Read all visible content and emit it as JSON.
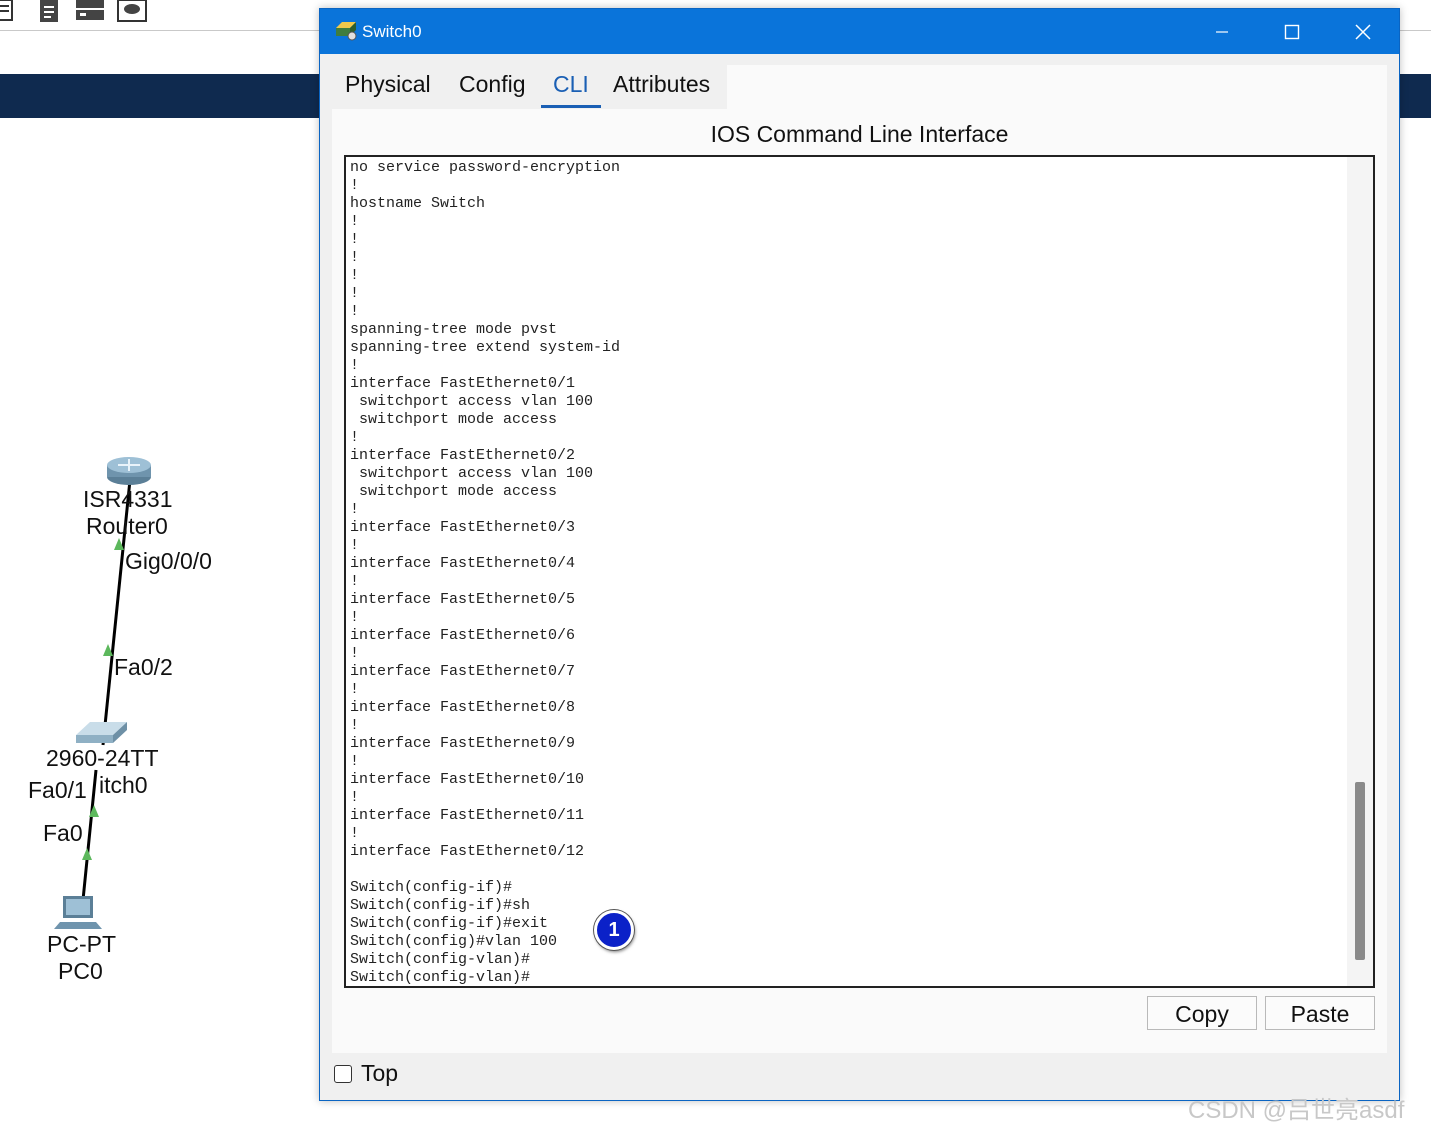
{
  "workspace": {
    "devices": {
      "router": {
        "model": "ISR4331",
        "name": "Router0"
      },
      "switch": {
        "model": "2960-24TT",
        "name_partial": "itch0"
      },
      "pc": {
        "model": "PC-PT",
        "name": "PC0"
      }
    },
    "ports": {
      "router_port": "Gig0/0/0",
      "switch_up_port": "Fa0/2",
      "switch_down_port": "Fa0/1",
      "pc_port": "Fa0"
    }
  },
  "window": {
    "title": "Switch0",
    "tabs": [
      "Physical",
      "Config",
      "CLI",
      "Attributes"
    ],
    "active_tab": "CLI",
    "panel_title": "IOS Command Line Interface",
    "cli_lines": [
      "no service password-encryption",
      "!",
      "hostname Switch",
      "!",
      "!",
      "!",
      "!",
      "!",
      "!",
      "spanning-tree mode pvst",
      "spanning-tree extend system-id",
      "!",
      "interface FastEthernet0/1",
      " switchport access vlan 100",
      " switchport mode access",
      "!",
      "interface FastEthernet0/2",
      " switchport access vlan 100",
      " switchport mode access",
      "!",
      "interface FastEthernet0/3",
      "!",
      "interface FastEthernet0/4",
      "!",
      "interface FastEthernet0/5",
      "!",
      "interface FastEthernet0/6",
      "!",
      "interface FastEthernet0/7",
      "!",
      "interface FastEthernet0/8",
      "!",
      "interface FastEthernet0/9",
      "!",
      "interface FastEthernet0/10",
      "!",
      "interface FastEthernet0/11",
      "!",
      "interface FastEthernet0/12",
      "",
      "Switch(config-if)#",
      "Switch(config-if)#sh",
      "Switch(config-if)#exit",
      "Switch(config)#vlan 100",
      "Switch(config-vlan)#",
      "Switch(config-vlan)#"
    ],
    "annotation_marker": "1",
    "copy_label": "Copy",
    "paste_label": "Paste",
    "top_checkbox_label": "Top",
    "top_checked": false
  },
  "watermark": "CSDN @吕世亮asdf",
  "colors": {
    "titlebar": "#0a74da",
    "navy_band": "#0f2a4f",
    "active_tab": "#1a5fb4",
    "marker": "#0b21c8",
    "link_endpoint": "#5cb85c"
  }
}
